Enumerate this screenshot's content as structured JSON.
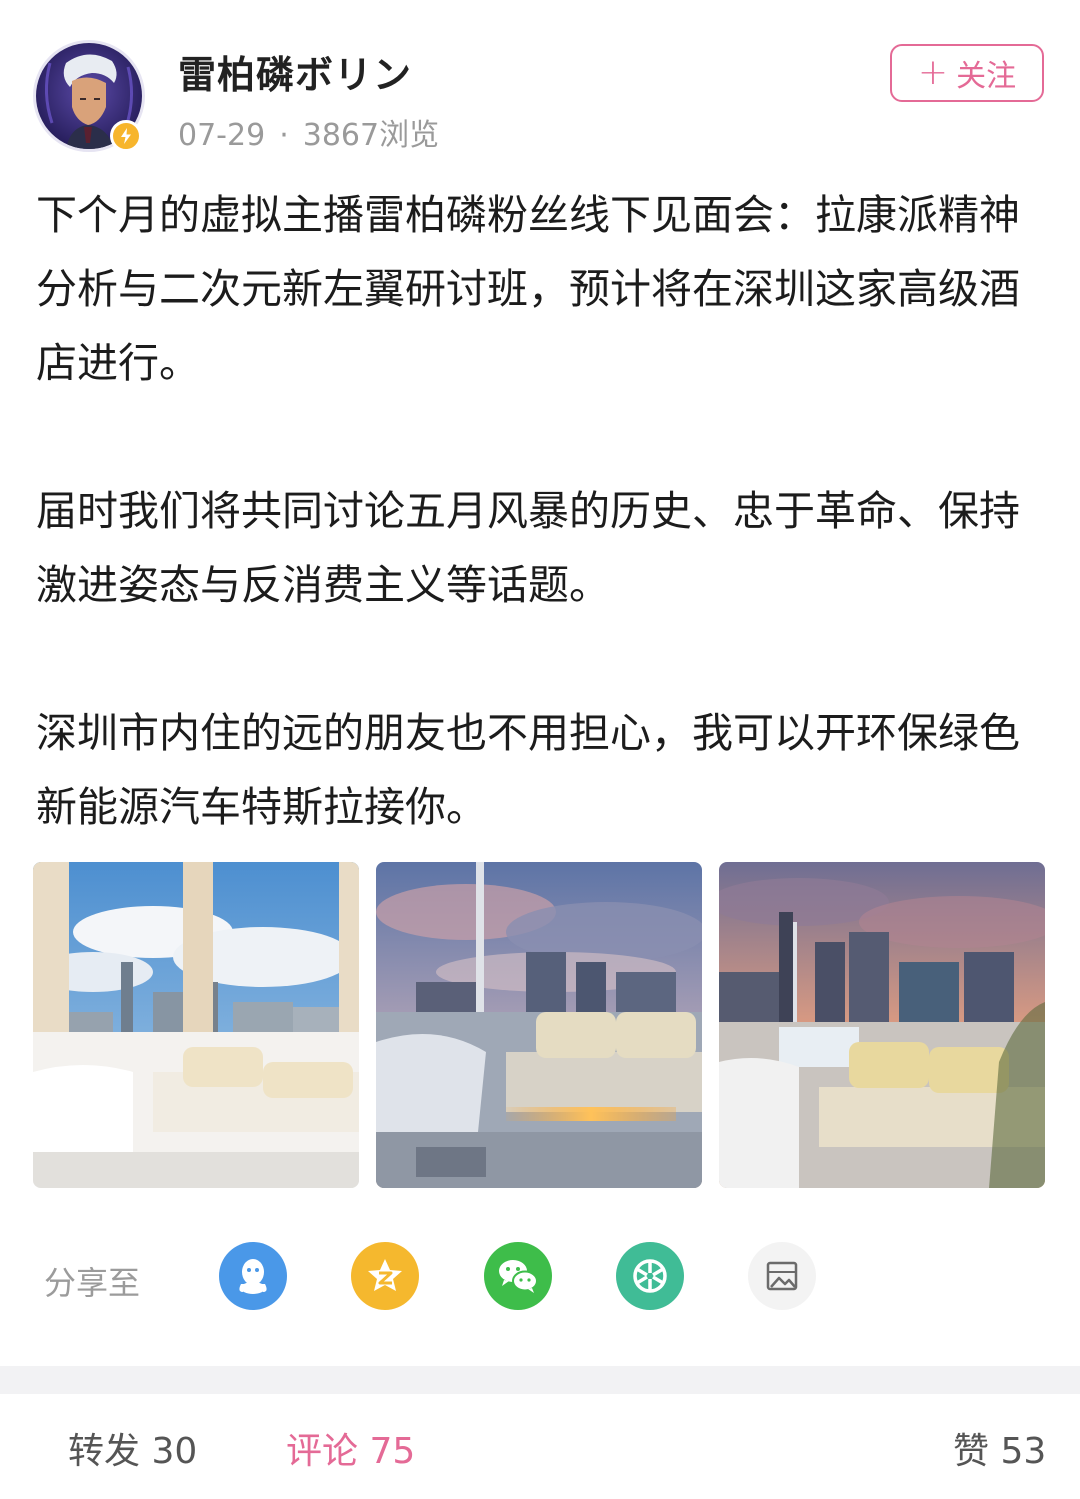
{
  "post": {
    "author": "雷柏磷ボリン",
    "date": "07-29",
    "separator": "·",
    "views": "3867浏览",
    "follow_label": "关注",
    "follow_plus": "+",
    "paragraphs": [
      "下个月的虚拟主播雷柏磷粉丝线下见面会：拉康派精神分析与二次元新左翼研讨班，预计将在深圳这家高级酒店进行。",
      "届时我们将共同讨论五月风暴的历史、忠于革命、保持激进姿态与反消费主义等话题。",
      "深圳市内住的远的朋友也不用担心，我可以开环保绿色新能源汽车特斯拉接你。"
    ]
  },
  "share": {
    "label": "分享至",
    "targets": [
      {
        "icon": "qq-icon",
        "color": "#4a98e8"
      },
      {
        "icon": "qzone-icon",
        "color": "#f5b82e"
      },
      {
        "icon": "wechat-icon",
        "color": "#3ebd4a"
      },
      {
        "icon": "moments-icon",
        "color": "#40bc96"
      },
      {
        "icon": "save-image-icon",
        "color": "#f3f3f3"
      }
    ]
  },
  "actions": {
    "repost_label": "转发",
    "repost_count": "30",
    "comment_label": "评论",
    "comment_count": "75",
    "like_label": "赞",
    "like_count": "53"
  },
  "colors": {
    "accent": "#e46a96",
    "badge": "#f7b52c"
  }
}
